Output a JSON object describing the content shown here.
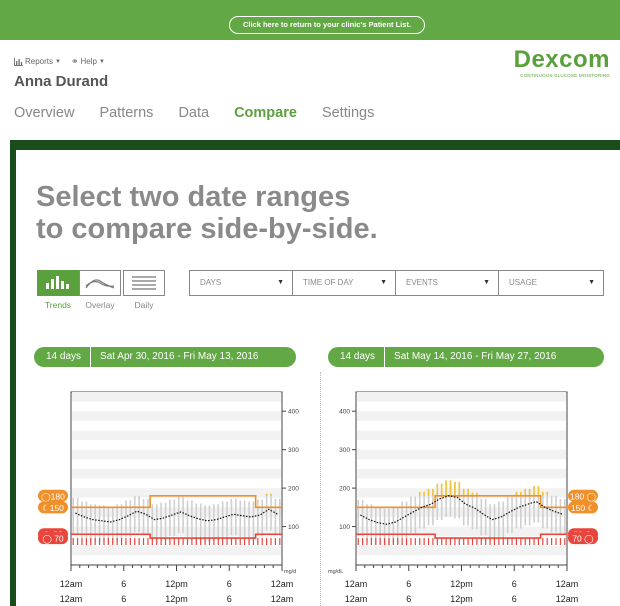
{
  "topbar": {
    "return_link": "Click here to return to your clinic's Patient List."
  },
  "menu": {
    "reports": "Reports",
    "help": "Help"
  },
  "patient": {
    "name": "Anna Durand"
  },
  "logo": {
    "word": "Dexcom",
    "tagline": "CONTINUOUS GLUCOSE MONITORING"
  },
  "tabs": [
    {
      "label": "Overview",
      "active": false
    },
    {
      "label": "Patterns",
      "active": false
    },
    {
      "label": "Data",
      "active": false
    },
    {
      "label": "Compare",
      "active": true
    },
    {
      "label": "Settings",
      "active": false
    }
  ],
  "headline": {
    "line1": "Select two date ranges",
    "line2": "to compare side-by-side."
  },
  "view_toggle": [
    {
      "label": "Trends",
      "icon": "bar-chart-icon",
      "selected": true
    },
    {
      "label": "Overlay",
      "icon": "wave-icon",
      "selected": false
    },
    {
      "label": "Daily",
      "icon": "lines-icon",
      "selected": false
    }
  ],
  "dropdowns": {
    "days": "DAYS",
    "time_of_day": "TIME OF DAY",
    "events": "EVENTS",
    "usage": "USAGE"
  },
  "ranges": [
    {
      "days": "14 days",
      "dates": "Sat Apr 30, 2016 - Fri May 13, 2016"
    },
    {
      "days": "14 days",
      "dates": "Sat May 14, 2016 - Fri May 27, 2016"
    }
  ],
  "thresholds": {
    "high_day": "180",
    "high_night": "150",
    "low_night": "80",
    "low_day": "70"
  },
  "colors": {
    "green": "#5aa03c",
    "high": "#f0902a",
    "low": "#e8453c",
    "high_bar": "#f2c438"
  },
  "chart_data": [
    {
      "type": "line",
      "title": "",
      "x": [
        "12am",
        "6",
        "12pm",
        "6",
        "12am"
      ],
      "y_ticks": [
        100,
        200,
        300,
        400
      ],
      "ylim": [
        0,
        450
      ],
      "ylabel": "mg/d",
      "target_range_upper": [
        150,
        150,
        180,
        180,
        150
      ],
      "target_range_lower": [
        80,
        80,
        70,
        70,
        80
      ],
      "series": [
        {
          "values": [
            135,
            125,
            118,
            115,
            112,
            118,
            128,
            140,
            132,
            118,
            122,
            130,
            138,
            128,
            120,
            115,
            118,
            125,
            132,
            128,
            125,
            130,
            145,
            132
          ]
        }
      ]
    },
    {
      "type": "line",
      "title": "",
      "x": [
        "12am",
        "6",
        "12pm",
        "6",
        "12am"
      ],
      "y_ticks": [
        100,
        200,
        300,
        400
      ],
      "ylim": [
        0,
        450
      ],
      "ylabel": "mg/dL",
      "target_range_upper": [
        150,
        150,
        180,
        180,
        150
      ],
      "target_range_lower": [
        80,
        80,
        70,
        70,
        80
      ],
      "series": [
        {
          "values": [
            130,
            118,
            110,
            106,
            112,
            125,
            138,
            150,
            158,
            172,
            180,
            176,
            158,
            148,
            132,
            118,
            125,
            138,
            150,
            158,
            165,
            150,
            140,
            132
          ]
        }
      ]
    }
  ],
  "axis_labels": [
    "12am",
    "6",
    "12pm",
    "6",
    "12am"
  ]
}
